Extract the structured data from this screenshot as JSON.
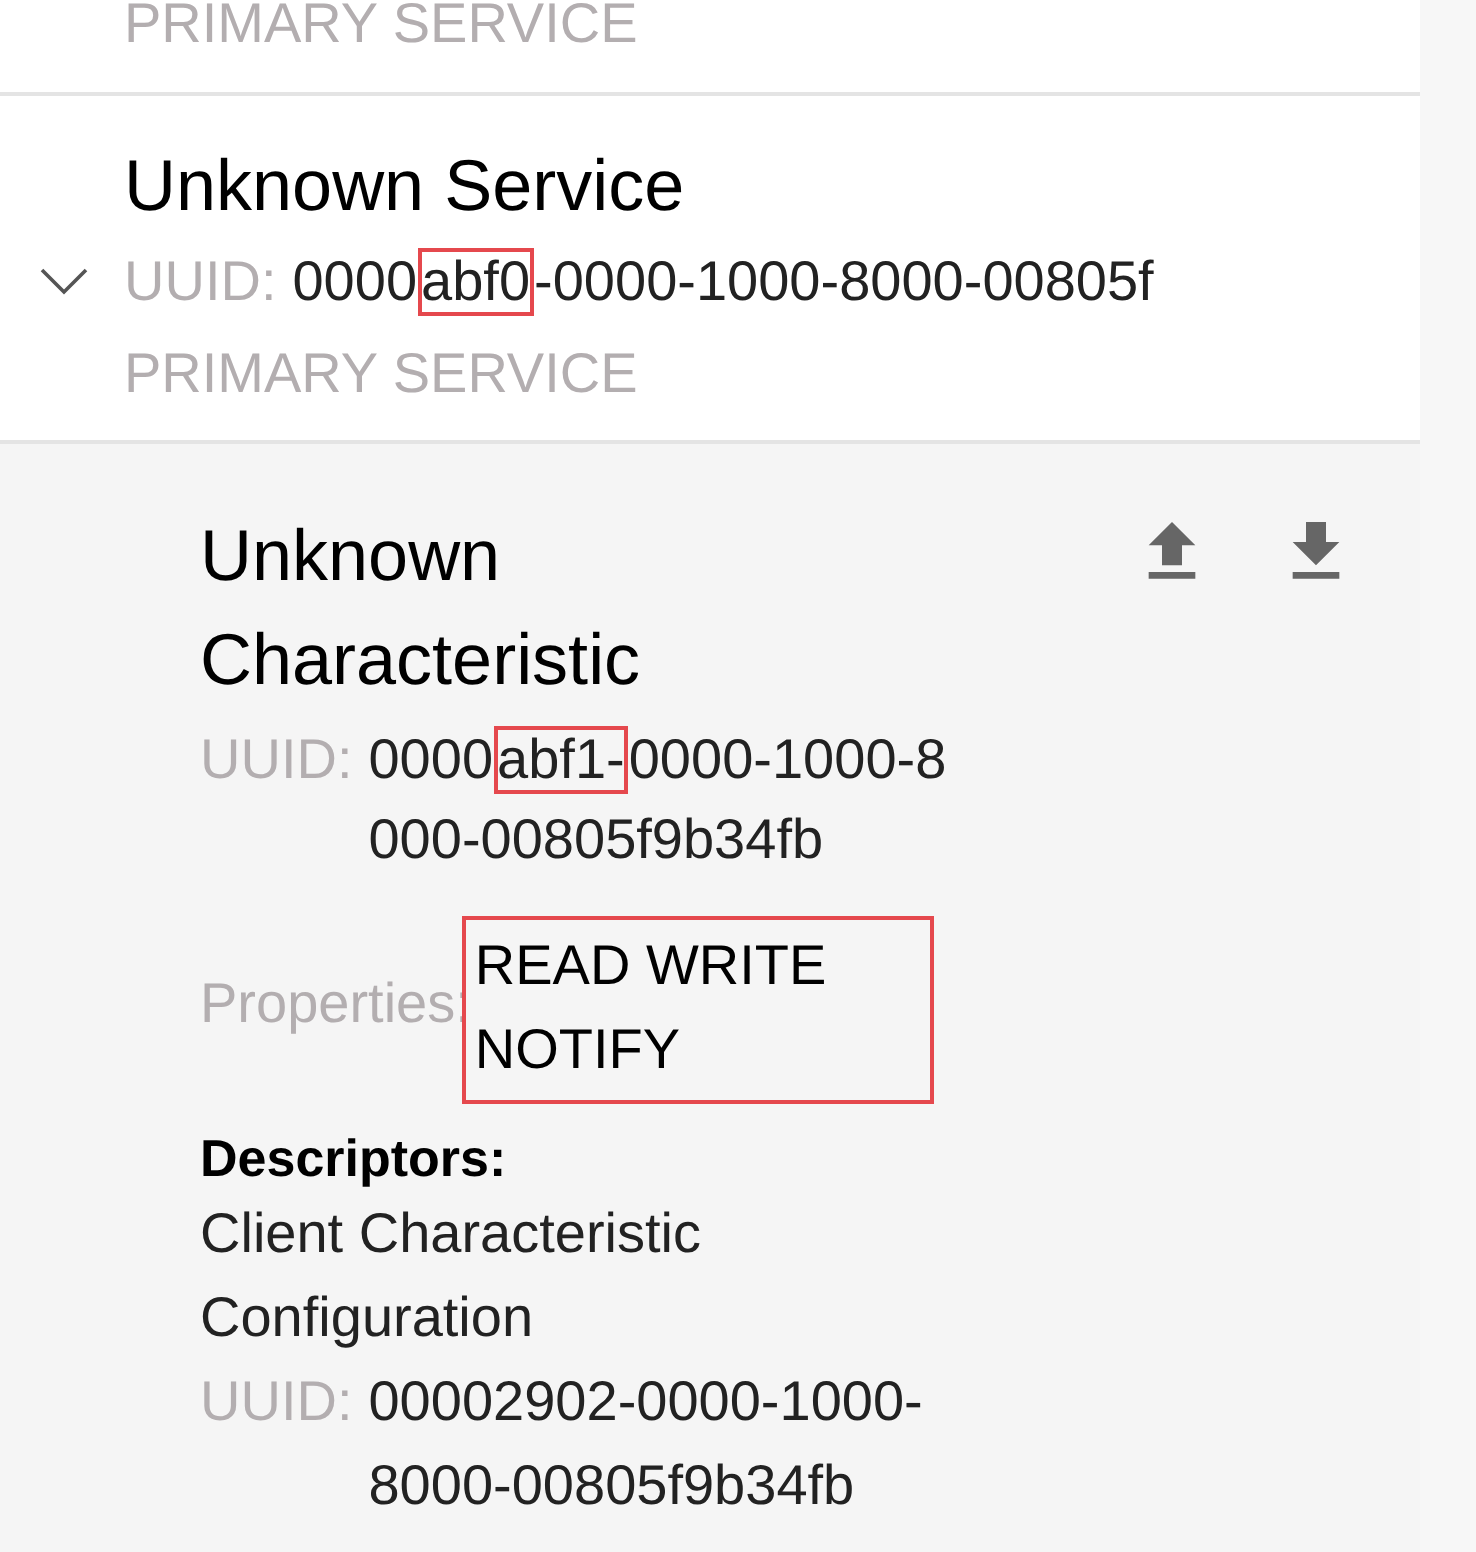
{
  "previous_service": {
    "type_label": "PRIMARY SERVICE"
  },
  "service": {
    "title": "Unknown Service",
    "expanded": true,
    "uuid_label": "UUID:",
    "uuid_segments": [
      {
        "text": "0000",
        "highlighted": false
      },
      {
        "text": "abf0",
        "highlighted": true
      },
      {
        "text": "-0000-1000-8000-00805f",
        "highlighted": false
      }
    ],
    "type_label": "PRIMARY SERVICE"
  },
  "characteristic": {
    "title_lines": [
      "Unknown",
      "Characteristic"
    ],
    "uuid_label": "UUID:",
    "uuid_lines": [
      [
        {
          "text": "0000",
          "highlighted": false
        },
        {
          "text": "abf1-",
          "highlighted": true
        },
        {
          "text": "0000-1000-8",
          "highlighted": false
        }
      ],
      [
        {
          "text": "000-00805f9b34fb",
          "highlighted": false
        }
      ]
    ],
    "properties_label": "Properties:",
    "properties_lines": [
      "READ WRITE",
      "NOTIFY"
    ],
    "properties_highlighted": true,
    "descriptors_label": "Descriptors:",
    "descriptor": {
      "name_lines": [
        "Client Characteristic",
        "Configuration"
      ],
      "uuid_label": "UUID:",
      "uuid_lines": [
        "00002902-0000-1000-",
        "8000-00805f9b34fb"
      ]
    }
  }
}
